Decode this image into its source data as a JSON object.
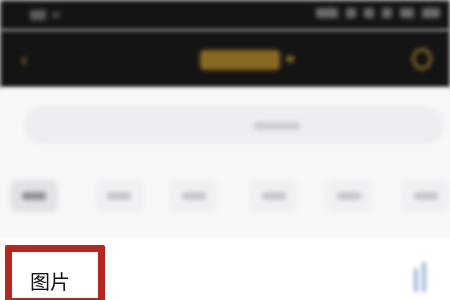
{
  "content": {
    "section_label": "图片"
  },
  "colors": {
    "header_bg": "#141414",
    "accent_gold": "#8a6a22",
    "highlight_red": "#b7261f",
    "page_bg": "#f6f7f9"
  },
  "icons": {
    "back": "back-arrow-icon",
    "nav_right": "search-icon"
  }
}
